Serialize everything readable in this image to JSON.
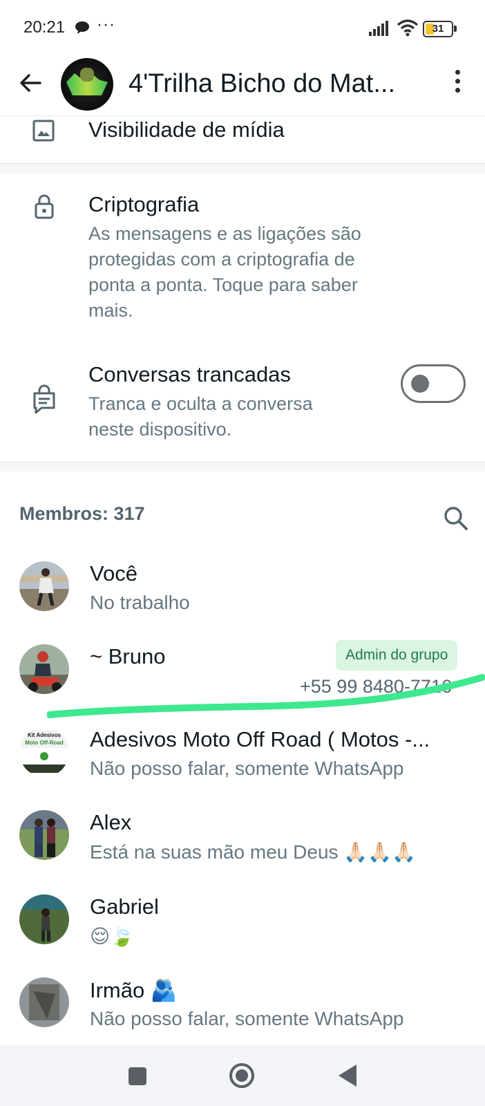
{
  "status_bar": {
    "time": "20:21",
    "dots": "···",
    "battery": "31"
  },
  "app_bar": {
    "group_name": "4'Trilha Bicho do Mat..."
  },
  "settings": {
    "media_visibility": {
      "title": "Visibilidade de mídia"
    },
    "encryption": {
      "title": "Criptografia",
      "subtitle_lines": [
        "As mensagens e as ligações são",
        "protegidas com a criptografia de",
        "ponta a ponta. Toque para saber",
        "mais."
      ]
    },
    "locked_chats": {
      "title": "Conversas trancadas",
      "subtitle_lines": [
        "Tranca e oculta a conversa",
        "neste dispositivo."
      ],
      "toggle_on": false
    }
  },
  "members": {
    "header": "Membros: 317",
    "list": [
      {
        "name": "Você",
        "status": "No trabalho"
      },
      {
        "name": "~ Bruno",
        "badge": "Admin do grupo",
        "phone": "+55 99 8480-7716"
      },
      {
        "name": "Adesivos Moto Off Road ( Motos -...",
        "status": "Não posso falar, somente WhatsApp",
        "avatar_text_1": "Kit Adesivos",
        "avatar_text_2": "Moto Off-Road"
      },
      {
        "name": "Alex",
        "status": "Está na suas mão meu Deus 🙏🏻🙏🏻🙏🏻"
      },
      {
        "name": "Gabriel",
        "status": "😌🍃"
      },
      {
        "name": "Irmão 🫂",
        "status": "Não posso falar, somente WhatsApp"
      }
    ]
  },
  "colors": {
    "accent_green": "#25d366",
    "badge_bg": "#daf5e2",
    "badge_text": "#1e7a4e",
    "secondary_text": "#667781"
  }
}
